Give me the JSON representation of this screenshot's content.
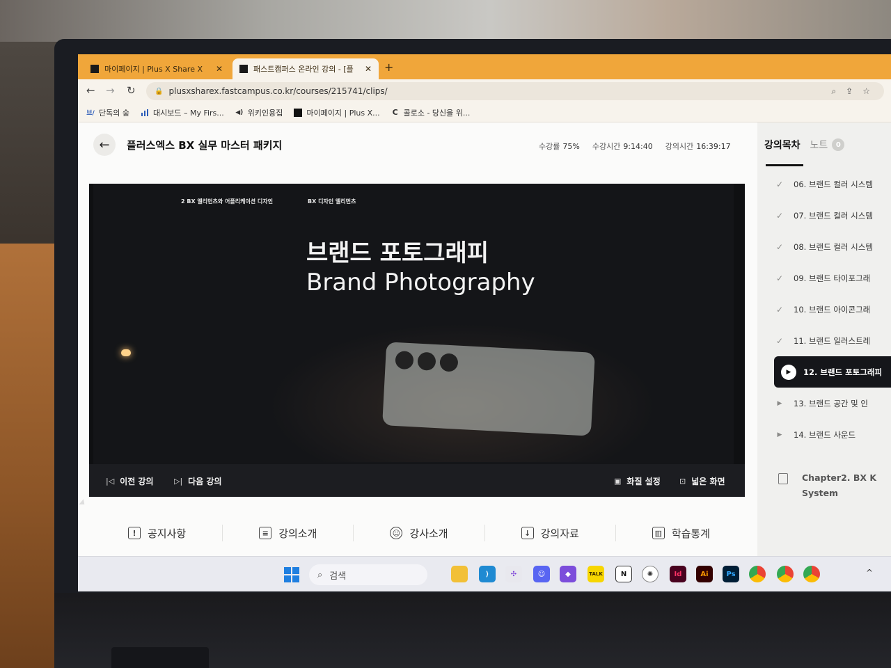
{
  "browser": {
    "tabs": [
      {
        "title": "마이페이지 | Plus X Share X",
        "active": false
      },
      {
        "title": "패스트캠퍼스 온라인 강의 - [플",
        "active": true
      }
    ],
    "new_tab": "+",
    "url": "plusxsharex.fastcampus.co.kr/courses/215741/clips/",
    "bookmarks": [
      {
        "icon": "브/",
        "label": "단독의 숲"
      },
      {
        "icon": "chart-icon",
        "label": "대시보드 – My Firs..."
      },
      {
        "icon": "sound-icon",
        "label": "위키인용집"
      },
      {
        "icon": "square-icon",
        "label": "마이페이지 | Plus X..."
      },
      {
        "icon": "C",
        "label": "콜로소 - 당신을 위..."
      }
    ]
  },
  "course": {
    "title": "플러스엑스 BX 실무 마스터 패키지",
    "stats": [
      {
        "label": "수강률",
        "value": "75%"
      },
      {
        "label": "수강시간",
        "value": "9:14:40"
      },
      {
        "label": "강의시간",
        "value": "16:39:17"
      }
    ]
  },
  "player": {
    "crumbs": [
      "2 BX 엘리먼츠와 어플리케이션 디자인",
      "BX 디자인 엘리먼츠"
    ],
    "slide_title_kr": "브랜드 포토그래피",
    "slide_title_en": "Brand Photography",
    "prev_label": "이전 강의",
    "next_label": "다음 강의",
    "quality_label": "화질 설정",
    "wide_label": "넓은 화면"
  },
  "page_tabs": [
    {
      "icon": "!",
      "label": "공지사항"
    },
    {
      "icon": "≡",
      "label": "강의소개"
    },
    {
      "icon": "☺",
      "label": "강사소개"
    },
    {
      "icon": "↓",
      "label": "강의자료"
    },
    {
      "icon": "▥",
      "label": "학습통계"
    }
  ],
  "sidebar": {
    "tab_toc": "강의목차",
    "tab_notes": "노트",
    "notes_count": "0",
    "lessons": [
      {
        "label": "06. 브랜드 컬러 시스템",
        "state": "done"
      },
      {
        "label": "07. 브랜드 컬러 시스템",
        "state": "done"
      },
      {
        "label": "08. 브랜드 컬러 시스템",
        "state": "done"
      },
      {
        "label": "09. 브랜드 타이포그래",
        "state": "done"
      },
      {
        "label": "10. 브랜드 아이콘그래",
        "state": "done"
      },
      {
        "label": "11. 브랜드 일러스트레",
        "state": "done"
      },
      {
        "label": "12. 브랜드 포토그래피",
        "state": "active"
      },
      {
        "label": "13. 브랜드 공간 및 인",
        "state": "todo"
      },
      {
        "label": "14. 브랜드 사운드",
        "state": "todo"
      }
    ],
    "chapter_line1": "Chapter2. BX K",
    "chapter_line2": "System"
  },
  "taskbar": {
    "search_label": "검색",
    "apps": [
      "explorer-icon",
      "vscode-icon",
      "figma-icon",
      "discord-icon",
      "obsidian-icon",
      "kakaotalk-icon",
      "notion-icon",
      "chatgpt-icon",
      "indesign-icon",
      "illustrator-icon",
      "photoshop-icon",
      "chrome-icon",
      "chrome-icon",
      "chrome-icon"
    ],
    "app_texts": {
      "kakao": "TALK",
      "notion": "N",
      "indesign": "Id",
      "illustrator": "Ai",
      "photoshop": "Ps"
    },
    "tray": "^"
  }
}
